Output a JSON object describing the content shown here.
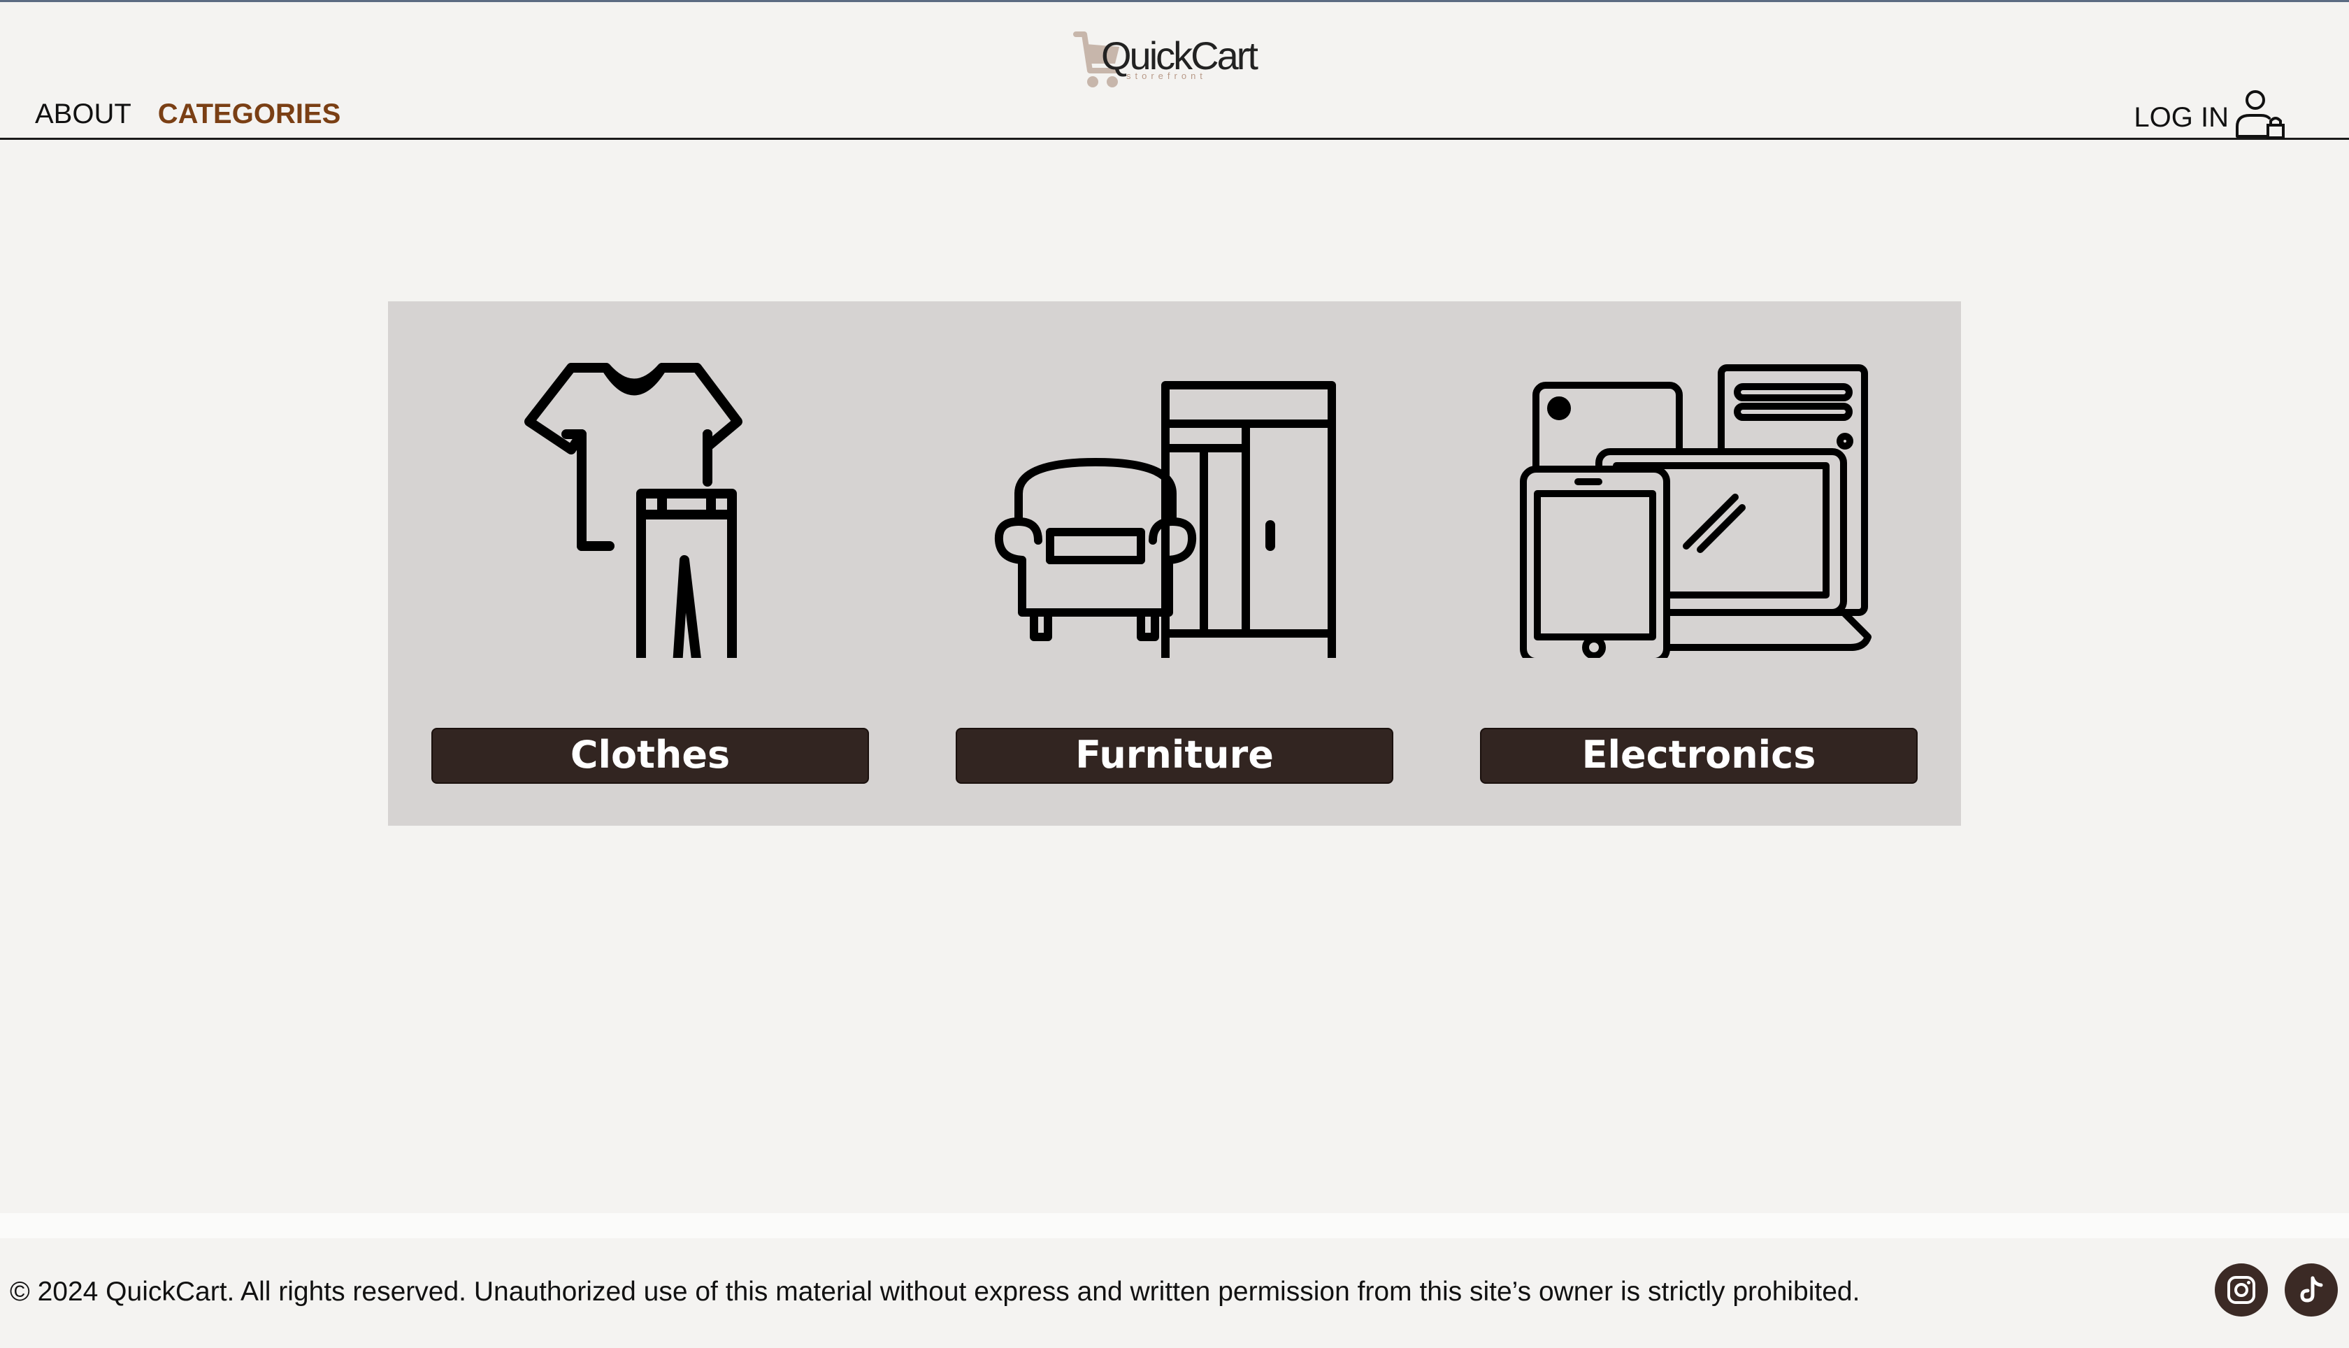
{
  "brand": {
    "name": "QuickCart",
    "tagline": "storefront"
  },
  "nav": {
    "about": "ABOUT",
    "categories": "CATEGORIES",
    "active": "CATEGORIES"
  },
  "auth": {
    "login_label": "LOG IN",
    "icon": "user-lock-icon"
  },
  "categories": [
    {
      "label": "Clothes",
      "icon": "clothes-icon"
    },
    {
      "label": "Furniture",
      "icon": "furniture-icon"
    },
    {
      "label": "Electronics",
      "icon": "electronics-icon"
    }
  ],
  "footer": {
    "copyright": "© 2024 QuickCart. All rights reserved. Unauthorized use of this material without express and written permission from this site’s owner is strictly prohibited.",
    "social": [
      {
        "name": "instagram",
        "icon": "instagram-icon"
      },
      {
        "name": "tiktok",
        "icon": "tiktok-icon"
      }
    ]
  },
  "colors": {
    "background": "#f4f3f1",
    "panel": "#d6d3d2",
    "button": "#322521",
    "accent": "#7a3f14",
    "social": "#3b2a25"
  }
}
